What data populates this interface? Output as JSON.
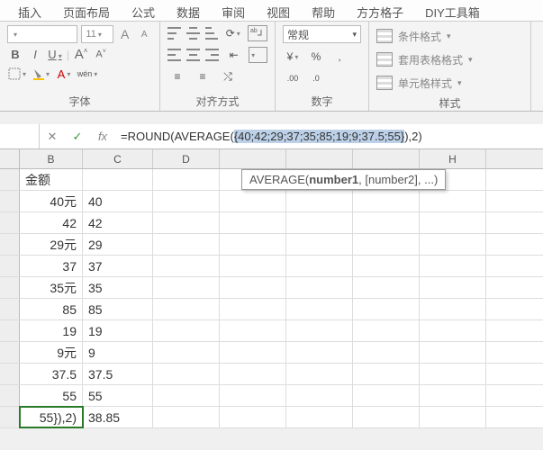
{
  "tabs": [
    "插入",
    "页面布局",
    "公式",
    "数据",
    "审阅",
    "视图",
    "帮助",
    "方方格子",
    "DIY工具箱"
  ],
  "ribbon": {
    "font": {
      "title": "字体",
      "size": "11",
      "bold": "B",
      "italic": "I",
      "underline": "U",
      "bigA": "A",
      "smallA": "A",
      "wen": "wén"
    },
    "align": {
      "title": "对齐方式"
    },
    "number": {
      "title": "数字",
      "format": "常规"
    },
    "styles": {
      "title": "样式",
      "cond": "条件格式",
      "table": "套用表格格式",
      "cell": "单元格样式"
    }
  },
  "fx": {
    "cross": "✕",
    "check": "✓",
    "fx": "fx",
    "prefix": "=ROUND(AVERAGE(",
    "selected": "{40;42;29;37;35;85;19;9;37.5;55}",
    "suffix": "),2)"
  },
  "tooltip": {
    "fn": "AVERAGE(",
    "b": "number1",
    "rest": ", [number2], ...)"
  },
  "columns": [
    "B",
    "C",
    "D",
    "",
    "",
    "",
    "H"
  ],
  "rows": [
    {
      "b": "金额",
      "balign": "l",
      "c": ""
    },
    {
      "b": "40元",
      "balign": "r",
      "c": "40"
    },
    {
      "b": "42",
      "balign": "r",
      "c": "42"
    },
    {
      "b": "29元",
      "balign": "r",
      "c": "29"
    },
    {
      "b": "37",
      "balign": "r",
      "c": "37"
    },
    {
      "b": "35元",
      "balign": "r",
      "c": "35"
    },
    {
      "b": "85",
      "balign": "r",
      "c": "85"
    },
    {
      "b": "19",
      "balign": "r",
      "c": "19"
    },
    {
      "b": "9元",
      "balign": "r",
      "c": "9"
    },
    {
      "b": "37.5",
      "balign": "r",
      "c": "37.5"
    },
    {
      "b": "55",
      "balign": "r",
      "c": "55"
    },
    {
      "b": "55}),2)",
      "balign": "r",
      "c": "38.85",
      "active": true
    }
  ]
}
